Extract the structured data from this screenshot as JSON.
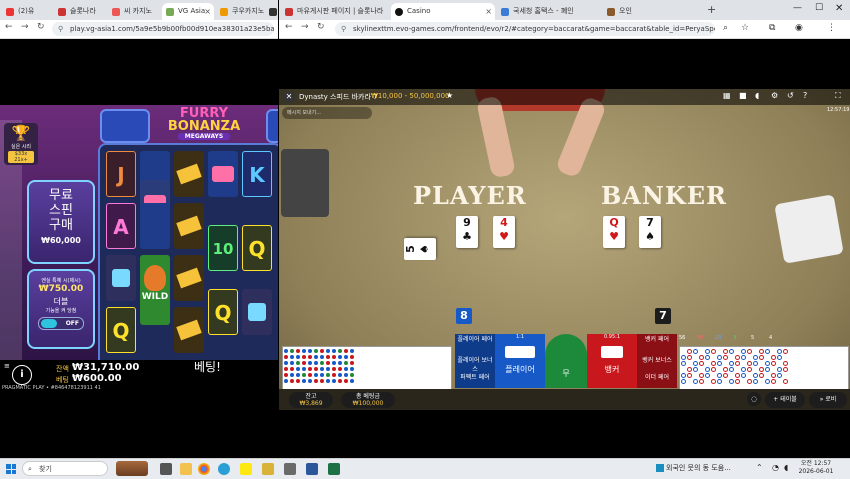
{
  "left_browser": {
    "tabs": [
      {
        "label": "(2)유"
      },
      {
        "label": "슬롯나라"
      },
      {
        "label": "씨 카지노"
      },
      {
        "label": "VG Asia"
      },
      {
        "label": "쿠우카지노"
      },
      {
        "label": ""
      }
    ],
    "url": "play.vg-asia1.com/5a9e5b9b00fb00d910ea38301a23e5ba7j21c076"
  },
  "slot": {
    "logo_line1": "FURRY",
    "logo_line2": "BONANZA",
    "logo_line3": "MEGAWAYS",
    "trophy_label": "실은 시리",
    "trophy_sub": "$33x 21x+",
    "buy_line1": "무료",
    "buy_line2": "스핀",
    "buy_line3": "구매",
    "buy_price": "₩60,000",
    "ante_title": "엔실 특혜 시(제시)",
    "ante_value": "₩750.00",
    "ante_label": "더블",
    "ante_sub": "기능을 켜 당첨",
    "ante_toggle": "OFF",
    "wild_label": "WILD",
    "credit_label": "잔액",
    "credit_value": "₩31,710.00",
    "bet_label": "베팅",
    "bet_value": "₩600.00",
    "message": "베팅!",
    "footer": "PRAGMATIC PLAY • #846478123911 41",
    "symbols": {
      "j": "J",
      "a": "A",
      "q": "Q",
      "k": "K",
      "ten": "10"
    }
  },
  "right_browser": {
    "tabs": [
      {
        "label": "마유게시판 페이지 | 슬롯나라"
      },
      {
        "label": "Casino"
      },
      {
        "label": "국세청 홈택스 - 폐인"
      },
      {
        "label": "오인"
      }
    ],
    "url": "skylinexttm.evo-games.com/frontend/evo/r2/#category=baccarat&game=baccarat&table_id=PeryaSpeedBac0078vt_id=tf12m6o2..."
  },
  "casino": {
    "table_name": "Dynasty 스피드 바카라 7",
    "limits": "₩10,000 - 50,000,000",
    "chat_placeholder": "메시지 보내기...",
    "time": "12:57:19",
    "player_label": "PLAYER",
    "banker_label": "BANKER",
    "player_cards": [
      {
        "rank": "5",
        "suit": "♠",
        "color": "blk"
      },
      {
        "rank": "9",
        "suit": "♣",
        "color": "blk"
      },
      {
        "rank": "4",
        "suit": "♥",
        "color": "red"
      }
    ],
    "banker_cards": [
      {
        "rank": "Q",
        "suit": "♥",
        "color": "red"
      },
      {
        "rank": "7",
        "suit": "♠",
        "color": "blk"
      }
    ],
    "player_score": "8",
    "banker_score": "7",
    "bets": {
      "player_pair": "플레이어 페어",
      "player_bonus": "플레이어 보너스",
      "perfect_pair": "퍼펙트 페어",
      "player": "플레이어",
      "tie": "무",
      "banker": "뱅커",
      "banker_pair": "뱅커 페어",
      "banker_bonus": "뱅커 보너스",
      "either_pair": "이더 페어",
      "player_payout": "1:1",
      "banker_payout": "0.95:1"
    },
    "stats": {
      "hands": "56",
      "banker": "30",
      "player": "23",
      "tie": "3",
      "pp": "5",
      "bp": "4"
    },
    "balance_label": "잔고",
    "balance_value": "₩3,869",
    "total_bet_label": "총 베팅금",
    "total_bet_value": "₩100,000",
    "table_button": "테이블",
    "lobby_button": "로비"
  },
  "taskbar": {
    "search_placeholder": "찾기",
    "news_text": "외국인 뭇의 동 도움...",
    "time": "오전 12:57",
    "date": "2026-06-01"
  },
  "colors": {
    "player_blue": "#1659c7",
    "banker_red": "#c8171d",
    "tie_green": "#1c8a3a"
  }
}
